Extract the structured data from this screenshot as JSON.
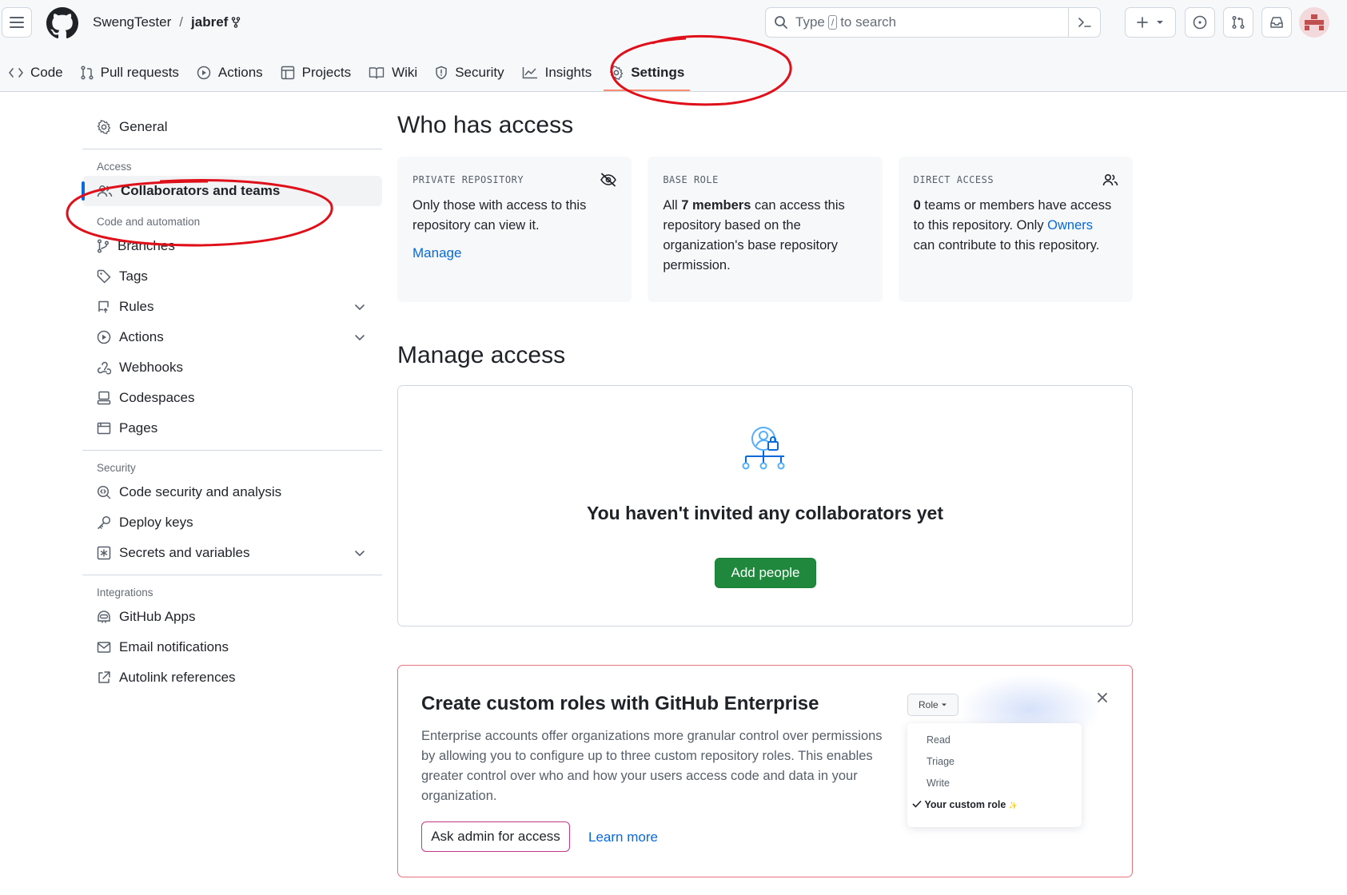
{
  "header": {
    "owner": "SwengTester",
    "separator": "/",
    "repo": "jabref",
    "search_prefix": "Type",
    "search_key": "/",
    "search_suffix": "to search"
  },
  "tabs": [
    {
      "label": "Code"
    },
    {
      "label": "Pull requests"
    },
    {
      "label": "Actions"
    },
    {
      "label": "Projects"
    },
    {
      "label": "Wiki"
    },
    {
      "label": "Security"
    },
    {
      "label": "Insights"
    },
    {
      "label": "Settings"
    }
  ],
  "sidebar": {
    "general": "General",
    "group_access": "Access",
    "collaborators": "Collaborators and teams",
    "group_code": "Code and automation",
    "branches": "Branches",
    "tags": "Tags",
    "rules": "Rules",
    "actions": "Actions",
    "webhooks": "Webhooks",
    "codespaces": "Codespaces",
    "pages": "Pages",
    "group_security": "Security",
    "code_security": "Code security and analysis",
    "deploy_keys": "Deploy keys",
    "secrets": "Secrets and variables",
    "group_integrations": "Integrations",
    "github_apps": "GitHub Apps",
    "email": "Email notifications",
    "autolink": "Autolink references"
  },
  "access": {
    "title": "Who has access",
    "private": {
      "label": "PRIVATE REPOSITORY",
      "text": "Only those with access to this repository can view it.",
      "link": "Manage"
    },
    "base_role": {
      "label": "BASE ROLE",
      "pre": "All ",
      "bold": "7 members",
      "post": " can access this repository based on the organization's base repository permission."
    },
    "direct": {
      "label": "DIRECT ACCESS",
      "bold": "0",
      "pre": " teams or members have access to this repository. Only ",
      "link": "Owners",
      "post": " can contribute to this repository."
    }
  },
  "manage": {
    "title": "Manage access",
    "empty": "You haven't invited any collaborators yet",
    "button": "Add people"
  },
  "promo": {
    "title": "Create custom roles with GitHub Enterprise",
    "body": "Enterprise accounts offer organizations more granular control over permissions by allowing you to configure up to three custom repository roles. This enables greater control over who and how your users access code and data in your organization.",
    "ask_button": "Ask admin for access",
    "learn_more": "Learn more",
    "role_button": "Role",
    "roles": [
      "Read",
      "Triage",
      "Write"
    ],
    "custom_role": "Your custom role",
    "sparkle": "✨"
  },
  "colors": {
    "accent": "#0969da",
    "primary_button": "#1f883d",
    "annotation": "#e0101a",
    "tab_underline": "#fd8c73"
  }
}
